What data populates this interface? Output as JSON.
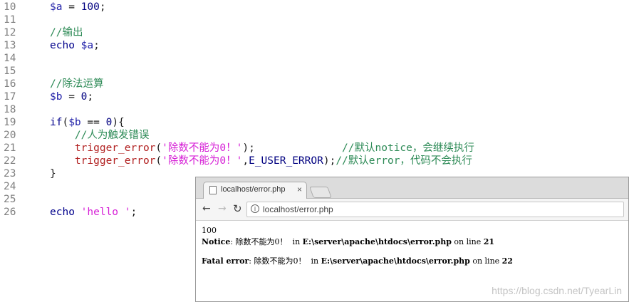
{
  "editor": {
    "lines": [
      {
        "n": "10",
        "parts": [
          [
            "var",
            "$a"
          ],
          [
            "pl",
            " = "
          ],
          [
            "num",
            "100"
          ],
          [
            "pl",
            ";"
          ]
        ]
      },
      {
        "n": "11",
        "parts": []
      },
      {
        "n": "12",
        "parts": [
          [
            "cm",
            "//输出"
          ]
        ]
      },
      {
        "n": "13",
        "parts": [
          [
            "kw",
            "echo "
          ],
          [
            "var",
            "$a"
          ],
          [
            "pl",
            ";"
          ]
        ]
      },
      {
        "n": "14",
        "parts": []
      },
      {
        "n": "15",
        "parts": []
      },
      {
        "n": "16",
        "parts": [
          [
            "cm",
            "//除法运算"
          ]
        ]
      },
      {
        "n": "17",
        "parts": [
          [
            "var",
            "$b"
          ],
          [
            "pl",
            " = "
          ],
          [
            "num",
            "0"
          ],
          [
            "pl",
            ";"
          ]
        ]
      },
      {
        "n": "18",
        "parts": []
      },
      {
        "n": "19",
        "parts": [
          [
            "kw",
            "if"
          ],
          [
            "pl",
            "("
          ],
          [
            "var",
            "$b"
          ],
          [
            "pl",
            " == "
          ],
          [
            "num",
            "0"
          ],
          [
            "pl",
            "){"
          ]
        ]
      },
      {
        "n": "20",
        "parts": [
          [
            "pl",
            "    "
          ],
          [
            "cm",
            "//人为触发错误"
          ]
        ]
      },
      {
        "n": "21",
        "parts": [
          [
            "pl",
            "    "
          ],
          [
            "fn",
            "trigger_error"
          ],
          [
            "pl",
            "("
          ],
          [
            "str",
            "'除数不能为0！'"
          ],
          [
            "pl",
            ");              "
          ],
          [
            "cm",
            "//默认notice，会继续执行"
          ]
        ]
      },
      {
        "n": "22",
        "parts": [
          [
            "pl",
            "    "
          ],
          [
            "fn",
            "trigger_error"
          ],
          [
            "pl",
            "("
          ],
          [
            "str",
            "'除数不能为0！'"
          ],
          [
            "pl",
            ","
          ],
          [
            "const",
            "E_USER_ERROR"
          ],
          [
            "pl",
            ");"
          ],
          [
            "cm",
            "//默认error，代码不会执行"
          ]
        ]
      },
      {
        "n": "23",
        "parts": [
          [
            "pl",
            "}"
          ]
        ]
      },
      {
        "n": "24",
        "parts": []
      },
      {
        "n": "25",
        "parts": []
      },
      {
        "n": "26",
        "parts": [
          [
            "kw",
            "echo "
          ],
          [
            "str",
            "'hello '"
          ],
          [
            "pl",
            ";"
          ]
        ]
      }
    ]
  },
  "browser": {
    "tab_title": "localhost/error.php",
    "tab_close": "×",
    "url": "localhost/error.php",
    "info_icon": "i",
    "back_icon": "←",
    "forward_icon": "→",
    "reload_icon": "↻",
    "output": {
      "line1": "100",
      "notice_label": "Notice",
      "notice_msg": ": 除数不能为0！  in ",
      "notice_path": "E:\\server\\apache\\htdocs\\error.php",
      "notice_line_text": " on line ",
      "notice_line": "21",
      "fatal_label": "Fatal error",
      "fatal_msg": ": 除数不能为0！  in ",
      "fatal_path": "E:\\server\\apache\\htdocs\\error.php",
      "fatal_line_text": " on line ",
      "fatal_line": "22"
    }
  },
  "watermark": "https://blog.csdn.net/TyearLin"
}
